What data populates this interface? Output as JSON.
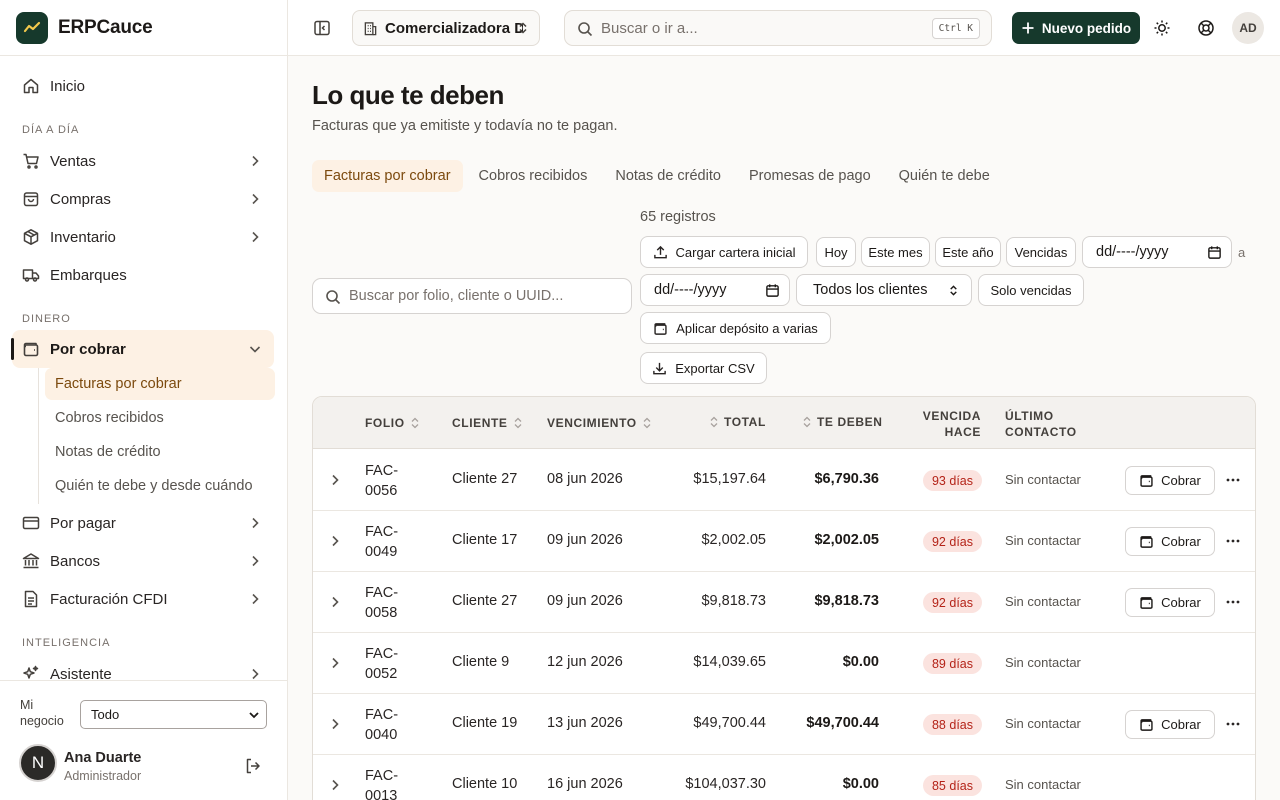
{
  "app": {
    "name": "ERPCauce"
  },
  "sidebar": {
    "home": "Inicio",
    "sections": {
      "dia": "DÍA A DÍA",
      "dinero": "DINERO",
      "inteligencia": "INTELIGENCIA"
    },
    "items": {
      "ventas": "Ventas",
      "compras": "Compras",
      "inventario": "Inventario",
      "embarques": "Embarques",
      "por_cobrar": "Por cobrar",
      "por_pagar": "Por pagar",
      "bancos": "Bancos",
      "facturacion": "Facturación CFDI",
      "asistente": "Asistente"
    },
    "sub_items": [
      "Facturas por cobrar",
      "Cobros recibidos",
      "Notas de crédito",
      "Quién te debe y desde cuándo"
    ],
    "negocio_label": "Mi negocio",
    "negocio_value": "Todo",
    "user": {
      "initial": "N",
      "name": "Ana Duarte",
      "role": "Administrador"
    }
  },
  "topbar": {
    "company": "Comercializadora Del Norte",
    "search_placeholder": "Buscar o ir a...",
    "shortcut": "Ctrl K",
    "new_button": "Nuevo pedido",
    "avatar": "AD"
  },
  "page": {
    "title": "Lo que te deben",
    "subtitle": "Facturas que ya emitiste y todavía no te pagan.",
    "tabs": [
      "Facturas por cobrar",
      "Cobros recibidos",
      "Notas de crédito",
      "Promesas de pago",
      "Quién te debe"
    ],
    "active_tab": 0,
    "records": "65 registros",
    "search_placeholder": "Buscar por folio, cliente o UUID...",
    "filters": {
      "cargar": "Cargar cartera inicial",
      "hoy": "Hoy",
      "este_mes": "Este mes",
      "este_anio": "Este año",
      "vencidas": "Vencidas",
      "date_placeholder": "dd/----/yyyy",
      "a": "a",
      "clientes": "Todos los clientes",
      "solo_vencidas": "Solo vencidas",
      "aplicar": "Aplicar depósito a varias",
      "exportar": "Exportar CSV"
    }
  },
  "table": {
    "headers": {
      "folio": "FOLIO",
      "cliente": "CLIENTE",
      "vencimiento": "VENCIMIENTO",
      "total": "TOTAL",
      "te_deben": "TE DEBEN",
      "vencida_1": "VENCIDA",
      "vencida_2": "HACE",
      "contacto_1": "ÚLTIMO",
      "contacto_2": "CONTACTO"
    },
    "cobrar_label": "Cobrar",
    "rows": [
      {
        "folio": "FAC-0056",
        "cliente": "Cliente 27",
        "vencimiento": "08 jun 2026",
        "total": "$15,197.64",
        "te_deben": "$6,790.36",
        "vencida": "93 días",
        "contacto": "Sin contactar",
        "cobrar": true
      },
      {
        "folio": "FAC-0049",
        "cliente": "Cliente 17",
        "vencimiento": "09 jun 2026",
        "total": "$2,002.05",
        "te_deben": "$2,002.05",
        "vencida": "92 días",
        "contacto": "Sin contactar",
        "cobrar": true
      },
      {
        "folio": "FAC-0058",
        "cliente": "Cliente 27",
        "vencimiento": "09 jun 2026",
        "total": "$9,818.73",
        "te_deben": "$9,818.73",
        "vencida": "92 días",
        "contacto": "Sin contactar",
        "cobrar": true
      },
      {
        "folio": "FAC-0052",
        "cliente": "Cliente 9",
        "vencimiento": "12 jun 2026",
        "total": "$14,039.65",
        "te_deben": "$0.00",
        "vencida": "89 días",
        "contacto": "Sin contactar",
        "cobrar": false
      },
      {
        "folio": "FAC-0040",
        "cliente": "Cliente 19",
        "vencimiento": "13 jun 2026",
        "total": "$49,700.44",
        "te_deben": "$49,700.44",
        "vencida": "88 días",
        "contacto": "Sin contactar",
        "cobrar": true
      },
      {
        "folio": "FAC-0013",
        "cliente": "Cliente 10",
        "vencimiento": "16 jun 2026",
        "total": "$104,037.30",
        "te_deben": "$0.00",
        "vencida": "85 días",
        "contacto": "Sin contactar",
        "cobrar": false
      }
    ]
  },
  "colors": {
    "brand": "#16392c",
    "accent_bg": "#fdf1e4",
    "accent_text": "#7c4a0e",
    "overdue_bg": "#fbe3df",
    "overdue_text": "#b42318"
  }
}
